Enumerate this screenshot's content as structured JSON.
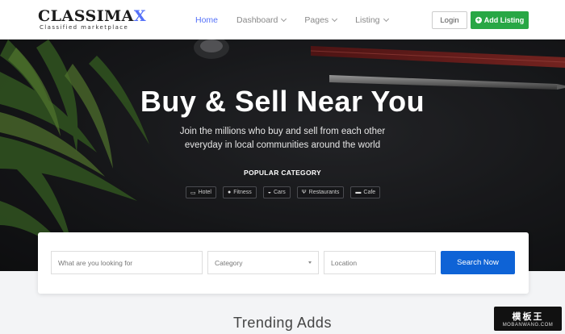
{
  "brand": {
    "name_main": "CLASSIMA",
    "name_accent": "X",
    "tagline": "Classified marketplace"
  },
  "nav": {
    "items": [
      {
        "label": "Home",
        "active": true,
        "dropdown": false
      },
      {
        "label": "Dashboard",
        "active": false,
        "dropdown": true
      },
      {
        "label": "Pages",
        "active": false,
        "dropdown": true
      },
      {
        "label": "Listing",
        "active": false,
        "dropdown": true
      }
    ],
    "login_label": "Login",
    "add_listing_label": "Add Listing"
  },
  "hero": {
    "title": "Buy & Sell Near You",
    "subtitle_line1": "Join the millions who buy and sell from each other",
    "subtitle_line2": "everyday in local communities around the world",
    "popular_title": "POPULAR CATEGORY",
    "categories": [
      {
        "icon": "bed-icon",
        "glyph": "▭",
        "label": "Hotel"
      },
      {
        "icon": "fitness-icon",
        "glyph": "●",
        "label": "Fitness"
      },
      {
        "icon": "car-icon",
        "glyph": "◒",
        "label": "Cars"
      },
      {
        "icon": "restaurant-icon",
        "glyph": "Ψ",
        "label": "Restaurants"
      },
      {
        "icon": "cafe-icon",
        "glyph": "▬",
        "label": "Cafe"
      }
    ]
  },
  "search": {
    "keyword_placeholder": "What are you looking for",
    "category_value": "Category",
    "location_placeholder": "Location",
    "button_label": "Search Now"
  },
  "section": {
    "trending_title": "Trending Adds"
  },
  "watermark": {
    "top": "模板王",
    "bottom": "MOBANWANG.COM"
  },
  "colors": {
    "accent": "#5672f9",
    "add_listing": "#28a745",
    "search_button": "#0e63d6"
  }
}
